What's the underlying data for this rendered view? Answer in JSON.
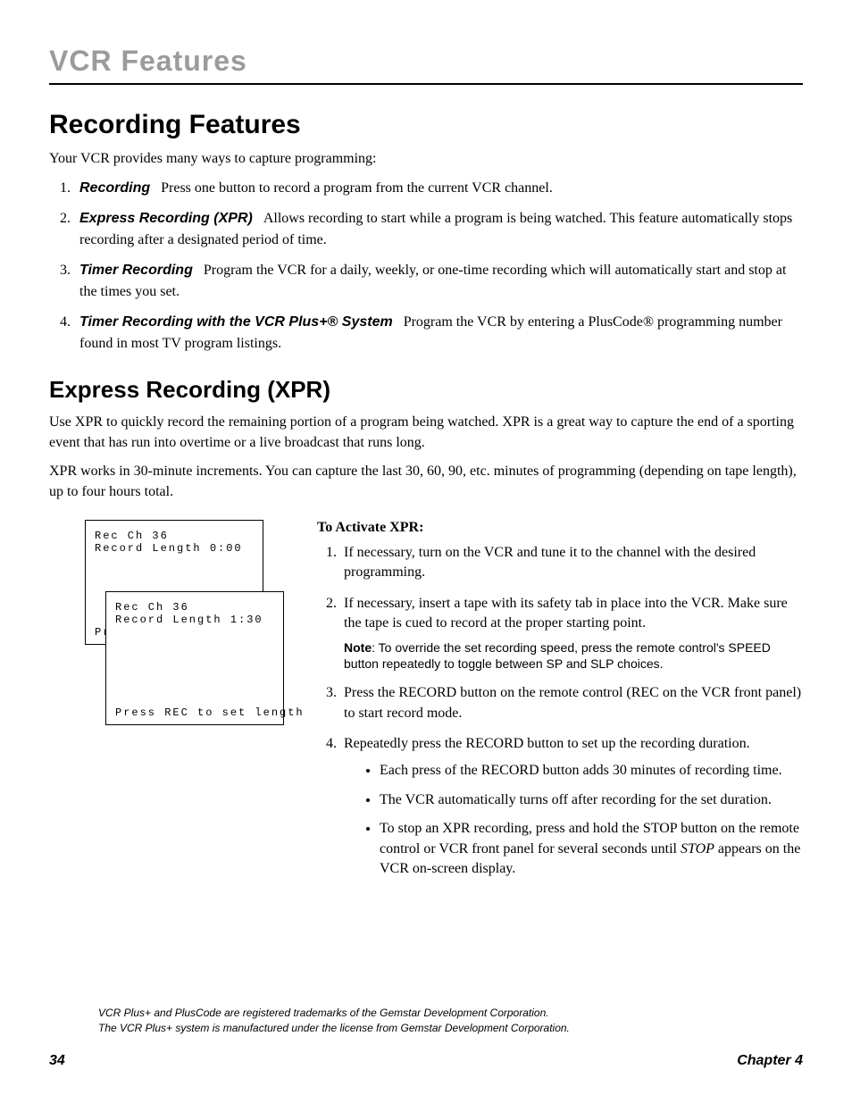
{
  "header": {
    "chapter_title": "VCR Features"
  },
  "sections": {
    "recording_features": {
      "heading": "Recording Features",
      "intro": "Your VCR provides many ways to capture programming:",
      "items": [
        {
          "label": "Recording",
          "text": "Press one button to record a program from the current VCR channel."
        },
        {
          "label": "Express Recording (XPR)",
          "text": "Allows recording to start while a program is being watched. This feature automatically stops recording after a designated period of time."
        },
        {
          "label": "Timer Recording",
          "text": "Program the VCR for a daily, weekly, or one-time recording which will automatically start and stop at the times you set."
        },
        {
          "label": "Timer Recording with the VCR Plus+® System",
          "text": "Program the VCR by entering a PlusCode® programming number found in most TV program listings."
        }
      ]
    },
    "xpr": {
      "heading": "Express Recording (XPR)",
      "para1": "Use XPR to quickly record the remaining portion of a program being watched. XPR is a great way to capture the end of a sporting event that has run into overtime or a live broadcast that runs long.",
      "para2": "XPR works in 30-minute increments. You can capture the last 30, 60, 90, etc. minutes of programming (depending on tape length), up to four hours total.",
      "osd1": {
        "line1": "Rec    Ch 36",
        "line2": "Record Length 0:00",
        "bottom": "Pr"
      },
      "osd2": {
        "line1": "Rec    Ch 36",
        "line2": "Record Length 1:30",
        "bottom": "Press REC to set length"
      },
      "activate": {
        "heading": "To Activate XPR:",
        "steps": {
          "s1": "If necessary, turn on the VCR and tune it to the channel with the desired programming.",
          "s2": "If necessary, insert a tape with its safety tab in place into the VCR. Make sure the tape is cued to record at the proper starting point.",
          "note_label": "Note",
          "note_text": ": To override the set recording speed, press the remote control's SPEED button repeatedly to toggle between SP and SLP choices.",
          "s3": "Press the RECORD button on the remote control (REC on the VCR front panel) to start record mode.",
          "s4": "Repeatedly press the RECORD button to set up the recording duration.",
          "bullets": {
            "b1": "Each press of the RECORD button adds 30 minutes of recording time.",
            "b2": "The VCR automatically turns off after recording for the set duration.",
            "b3a": "To stop an XPR recording, press and hold the STOP button on the remote control or VCR front panel for several seconds until ",
            "b3_stop": "STOP",
            "b3b": " appears on the VCR on-screen display."
          }
        }
      }
    }
  },
  "footnotes": {
    "f1": "VCR Plus+ and PlusCode are registered trademarks of the Gemstar Development Corporation.",
    "f2": "The VCR Plus+ system is manufactured under the license from Gemstar Development Corporation."
  },
  "footer": {
    "page_number": "34",
    "chapter": "Chapter 4"
  }
}
